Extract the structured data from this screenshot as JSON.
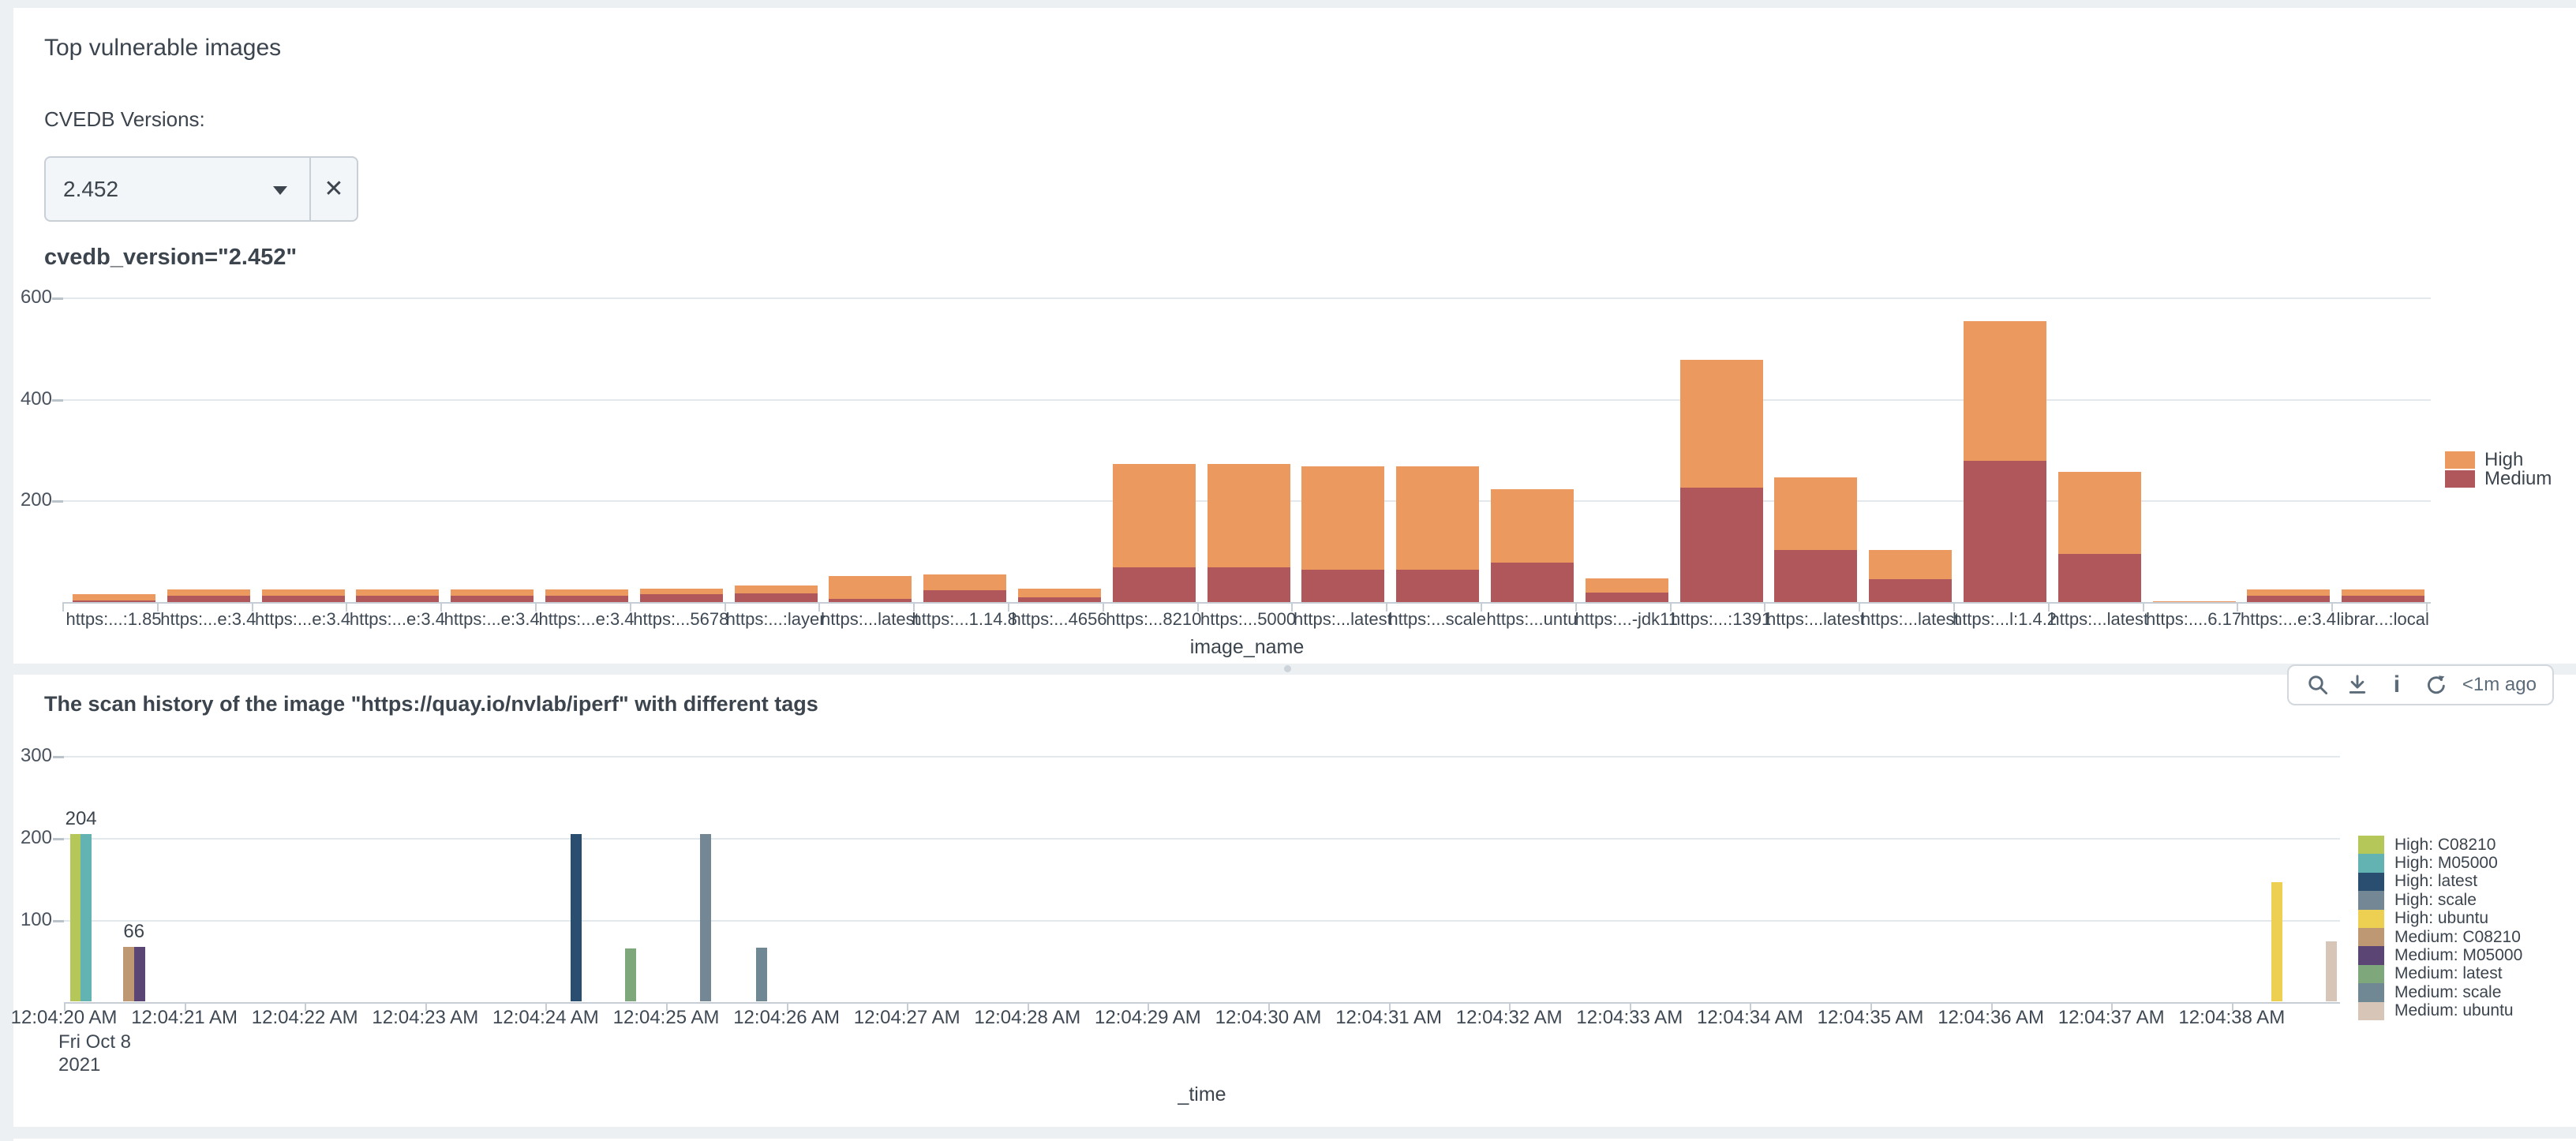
{
  "panel1": {
    "title": "Top vulnerable images",
    "filter_label": "CVEDB Versions:",
    "dropdown": {
      "value": "2.452",
      "clear_glyph": "✕"
    },
    "chart_title_prefix": "cvedb_version=\"",
    "chart_title_token": "2.452\""
  },
  "panel2": {
    "toolbar": {
      "icons": [
        "magnifier",
        "download",
        "info",
        "refresh"
      ],
      "age": "<1m ago"
    }
  },
  "chart_data": [
    {
      "type": "bar",
      "stacked": true,
      "title": "cvedb_version=\"2.452\"",
      "xlabel": "image_name",
      "ylim": [
        0,
        650
      ],
      "yticks": [
        200,
        400,
        600
      ],
      "grid": true,
      "legend_position": "right",
      "legend_order": [
        "High",
        "Medium"
      ],
      "categories": [
        "https:...:1.85",
        "https:...e:3.4",
        "https:...e:3.4",
        "https:...e:3.4",
        "https:...e:3.4",
        "https:...e:3.4",
        "https:...5678",
        "https:...:layer",
        "https:...latest",
        "https:...1.14.8",
        "https:...4656",
        "https:...8210",
        "https:...5000",
        "https:...latest",
        "https:...scale",
        "https:...untu",
        "https:...-jdk11",
        "https:...:1391",
        "https:...latest",
        "https:...latest",
        "https:...l:1.4.2",
        "https:...latest",
        "https:....6.17",
        "https:...e:3.4",
        "librar...:local"
      ],
      "series": [
        {
          "name": "High",
          "color": "#ec9960",
          "values": [
            13,
            12,
            12,
            12,
            12,
            12,
            12,
            16,
            45,
            30,
            17,
            204,
            204,
            204,
            204,
            145,
            28,
            252,
            143,
            57,
            274,
            162,
            1,
            13,
            13
          ]
        },
        {
          "name": "Medium",
          "color": "#af575a",
          "values": [
            3,
            13,
            13,
            13,
            13,
            13,
            15,
            17,
            6,
            24,
            10,
            68,
            68,
            64,
            64,
            77,
            18,
            225,
            102,
            45,
            279,
            95,
            1,
            12,
            12
          ]
        }
      ]
    },
    {
      "type": "bar",
      "stacked": false,
      "title": "The scan history of the image \"https://quay.io/nvlab/iperf\" with different tags",
      "xlabel": "_time",
      "ylim": [
        0,
        300
      ],
      "yticks": [
        100,
        200,
        300
      ],
      "grid": true,
      "legend_position": "right",
      "x_tick_labels": [
        "12:04:20 AM",
        "12:04:21 AM",
        "12:04:22 AM",
        "12:04:23 AM",
        "12:04:24 AM",
        "12:04:25 AM",
        "12:04:26 AM",
        "12:04:27 AM",
        "12:04:28 AM",
        "12:04:29 AM",
        "12:04:30 AM",
        "12:04:31 AM",
        "12:04:32 AM",
        "12:04:33 AM",
        "12:04:34 AM",
        "12:04:35 AM",
        "12:04:36 AM",
        "12:04:37 AM",
        "12:04:38 AM"
      ],
      "x_date_lines": [
        "Fri Oct 8",
        "2021"
      ],
      "series": [
        {
          "name": "High: C08210",
          "color": "#b6c75a",
          "points": [
            {
              "t": 0.05,
              "value": 204
            }
          ]
        },
        {
          "name": "High: M05000",
          "color": "#62b3b2",
          "points": [
            {
              "t": 0.14,
              "value": 204
            }
          ]
        },
        {
          "name": "High: latest",
          "color": "#294e70",
          "points": [
            {
              "t": 4.21,
              "value": 204
            }
          ]
        },
        {
          "name": "High: scale",
          "color": "#738795",
          "points": [
            {
              "t": 5.28,
              "value": 204
            }
          ]
        },
        {
          "name": "High: ubuntu",
          "color": "#edd051",
          "points": [
            {
              "t": 18.33,
              "value": 145
            }
          ]
        },
        {
          "name": "Medium: C08210",
          "color": "#bd9872",
          "points": [
            {
              "t": 0.49,
              "value": 66
            }
          ]
        },
        {
          "name": "Medium: M05000",
          "color": "#5a4575",
          "points": [
            {
              "t": 0.58,
              "value": 66
            }
          ]
        },
        {
          "name": "Medium: latest",
          "color": "#7ea77b",
          "points": [
            {
              "t": 4.66,
              "value": 64
            }
          ]
        },
        {
          "name": "Medium: scale",
          "color": "#708794",
          "points": [
            {
              "t": 5.75,
              "value": 65
            }
          ]
        },
        {
          "name": "Medium: ubuntu",
          "color": "#d7c6b7",
          "points": [
            {
              "t": 18.78,
              "value": 73
            }
          ]
        }
      ],
      "data_labels": [
        {
          "text": "204",
          "t": 0.05,
          "value": 204
        },
        {
          "text": "66",
          "t": 0.49,
          "value": 66
        }
      ]
    }
  ]
}
